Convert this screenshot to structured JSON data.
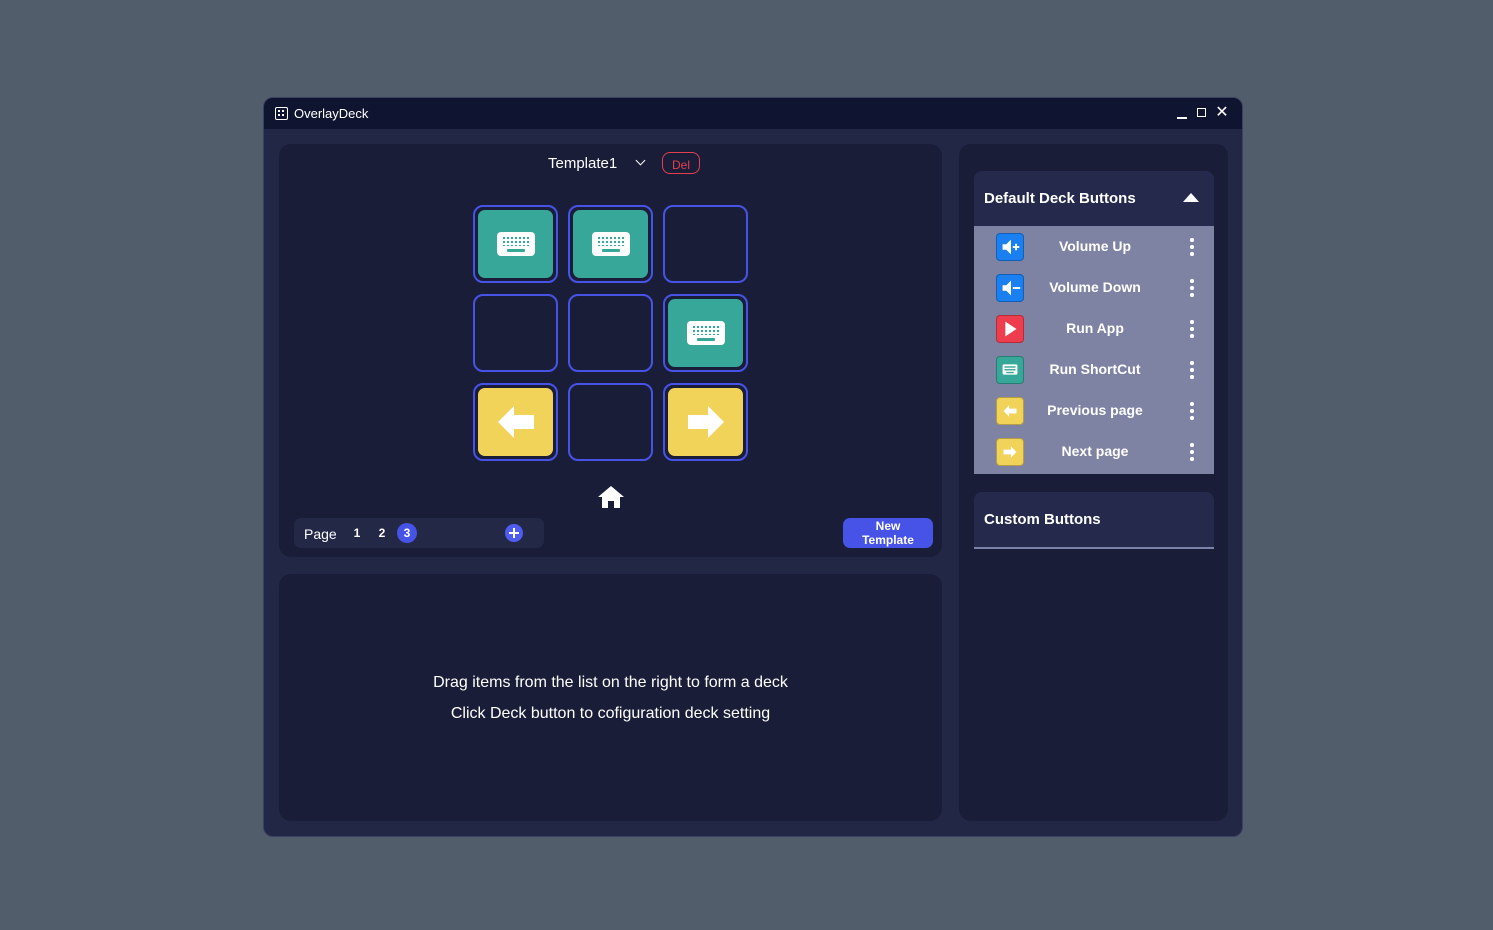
{
  "window": {
    "title": "OverlayDeck"
  },
  "deck": {
    "template_name": "Template1",
    "delete_label": "Del",
    "cells": [
      {
        "type": "shortcut",
        "color": "#36a798"
      },
      {
        "type": "shortcut",
        "color": "#36a798"
      },
      {
        "type": "empty"
      },
      {
        "type": "empty"
      },
      {
        "type": "empty"
      },
      {
        "type": "shortcut",
        "color": "#36a798"
      },
      {
        "type": "previous",
        "color": "#f2d35a"
      },
      {
        "type": "empty"
      },
      {
        "type": "next",
        "color": "#f2d35a"
      }
    ],
    "pager": {
      "label": "Page",
      "pages": [
        "1",
        "2",
        "3"
      ],
      "active_page": "3"
    },
    "new_template_label": "New Template"
  },
  "info": {
    "line1": "Drag items from the list on the right to form a deck",
    "line2": "Click Deck button to cofiguration deck setting"
  },
  "sidebar": {
    "default_title": "Default Deck Buttons",
    "default_buttons": [
      {
        "label": "Volume Up",
        "icon": "volume-up-icon",
        "color": "#1a7ff0"
      },
      {
        "label": "Volume Down",
        "icon": "volume-down-icon",
        "color": "#1a7ff0"
      },
      {
        "label": "Run App",
        "icon": "play-icon",
        "color": "#ee3d4d"
      },
      {
        "label": "Run ShortCut",
        "icon": "keyboard-icon",
        "color": "#36a798"
      },
      {
        "label": "Previous page",
        "icon": "arrow-left-icon",
        "color": "#f2d35a"
      },
      {
        "label": "Next page",
        "icon": "arrow-right-icon",
        "color": "#f2d35a"
      }
    ],
    "custom_title": "Custom Buttons"
  },
  "colors": {
    "accent": "#4653e6",
    "danger": "#e3404f",
    "teal": "#36a798",
    "yellow": "#f2d35a"
  }
}
